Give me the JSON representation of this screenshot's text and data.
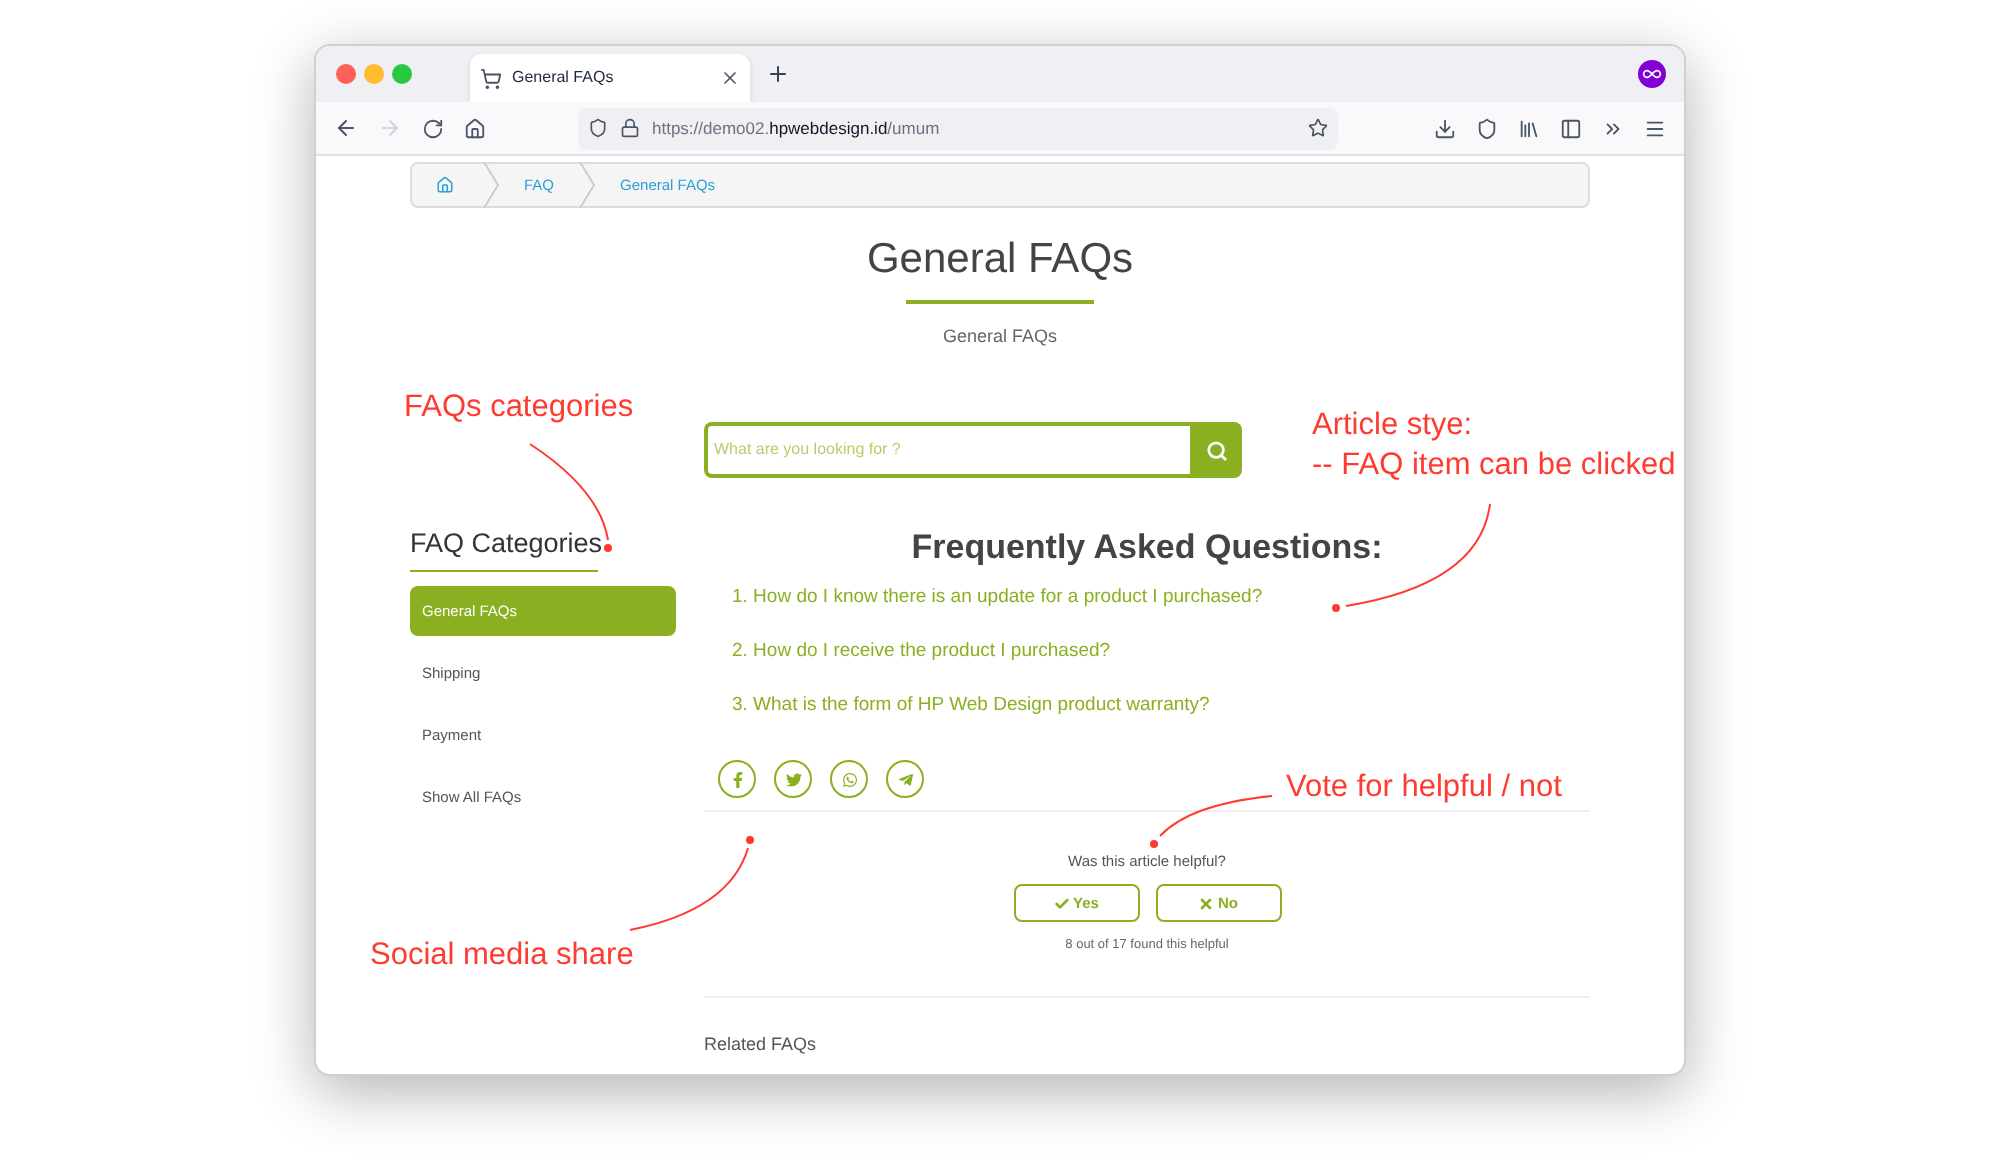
{
  "browser": {
    "tab_title": "General FAQs",
    "url_prefix": "https://demo02.",
    "url_domain": "hpwebdesign.id",
    "url_path": "/umum"
  },
  "breadcrumb": [
    {
      "label": "FAQ"
    },
    {
      "label": "General FAQs"
    }
  ],
  "page": {
    "title": "General FAQs",
    "subtitle": "General FAQs"
  },
  "sidebar": {
    "title": "FAQ Categories",
    "items": [
      {
        "label": "General FAQs",
        "selected": true
      },
      {
        "label": "Shipping",
        "selected": false
      },
      {
        "label": "Payment",
        "selected": false
      },
      {
        "label": "Show All FAQs",
        "selected": false
      }
    ]
  },
  "search": {
    "placeholder": "What are you looking for ?"
  },
  "faq": {
    "heading": "Frequently Asked Questions:",
    "questions": [
      "1. How do I know there is an update for a product I purchased?",
      "2. How do I receive the product I purchased?",
      "3. What is the form of HP Web Design product warranty?"
    ]
  },
  "vote": {
    "question": "Was this article helpful?",
    "yes": "Yes",
    "no": "No",
    "tally": "8 out of 17 found this helpful"
  },
  "related_heading": "Related FAQs",
  "annotations": [
    {
      "lines": [
        "FAQs categories"
      ]
    },
    {
      "lines": [
        "Article stye:",
        "-- FAQ item can be clicked"
      ]
    },
    {
      "lines": [
        "Vote for helpful / not"
      ]
    },
    {
      "lines": [
        "Social media share"
      ]
    }
  ]
}
